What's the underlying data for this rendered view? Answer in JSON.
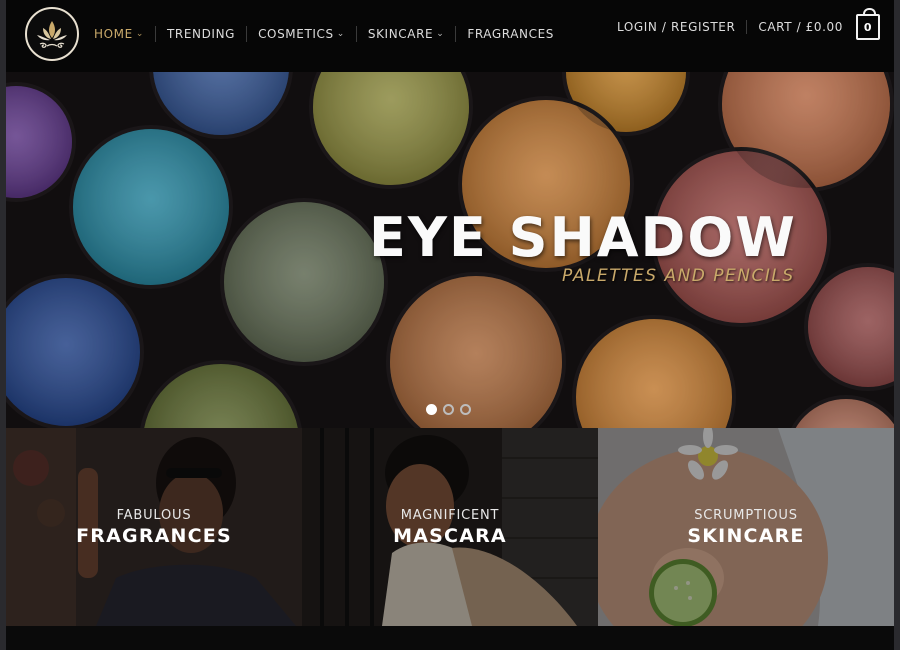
{
  "nav": {
    "items": [
      {
        "label": "HOME",
        "dropdown": true,
        "active": true
      },
      {
        "label": "TRENDING",
        "dropdown": false,
        "active": false
      },
      {
        "label": "COSMETICS",
        "dropdown": true,
        "active": false
      },
      {
        "label": "SKINCARE",
        "dropdown": true,
        "active": false
      },
      {
        "label": "FRAGRANCES",
        "dropdown": false,
        "active": false
      }
    ],
    "chevron": "⌄"
  },
  "account": {
    "login_label": "LOGIN / REGISTER",
    "cart_label": "CART / £0.00",
    "cart_count": "0"
  },
  "hero": {
    "title": "EYE SHADOW",
    "subtitle": "PALETTES AND PENCILS",
    "slides": 3,
    "active_slide": 1
  },
  "tiles": [
    {
      "small": "FABULOUS",
      "large": "FRAGRANCES"
    },
    {
      "small": "MAGNIFICENT",
      "large": "MASCARA"
    },
    {
      "small": "SCRUMPTIOUS",
      "large": "SKINCARE"
    }
  ],
  "colors": {
    "accent_gold": "#c9a96a",
    "header_bg": "#060606",
    "nav_text": "#dcdcdc"
  },
  "icons": {
    "logo": "lotus-logo-icon",
    "cart": "shopping-bag-icon"
  }
}
